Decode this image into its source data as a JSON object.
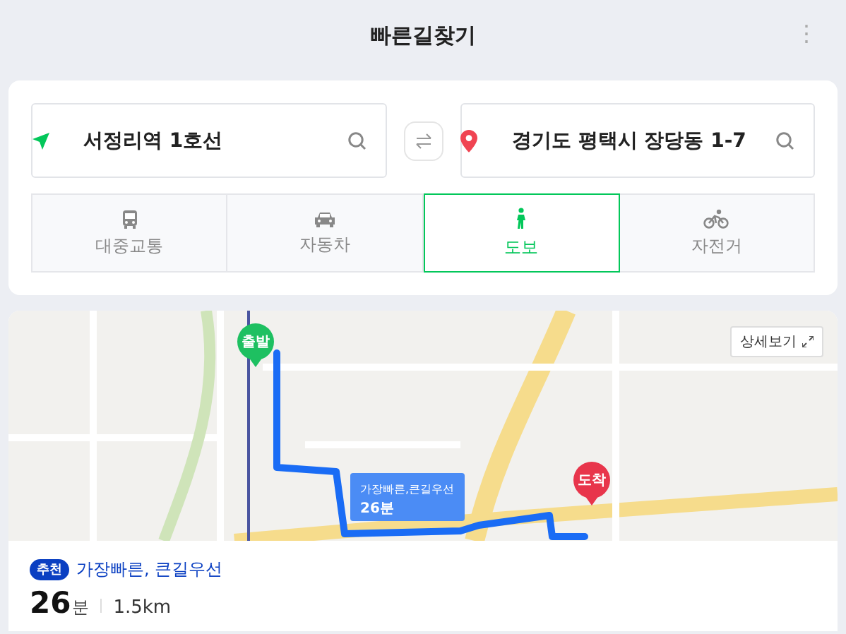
{
  "header": {
    "title": "빠른길찾기",
    "more_icon": "⋮"
  },
  "route_inputs": {
    "origin": {
      "value": "서정리역 1호선"
    },
    "destination": {
      "value": "경기도 평택시 장당동 1-7"
    }
  },
  "modes": [
    {
      "kind": "bus",
      "label": "대중교통",
      "selected": false
    },
    {
      "kind": "car",
      "label": "자동차",
      "selected": false
    },
    {
      "kind": "walk",
      "label": "도보",
      "selected": true
    },
    {
      "kind": "bike",
      "label": "자전거",
      "selected": false
    }
  ],
  "map": {
    "start_pin": "출발",
    "end_pin": "도착",
    "route_label": {
      "title": "가장빠른,큰길우선",
      "time": "26분"
    },
    "detail_button": "상세보기"
  },
  "result": {
    "badge": "추천",
    "title": "가장빠른, 큰길우선",
    "duration": "26",
    "duration_unit": "분",
    "distance": "1.5km"
  }
}
